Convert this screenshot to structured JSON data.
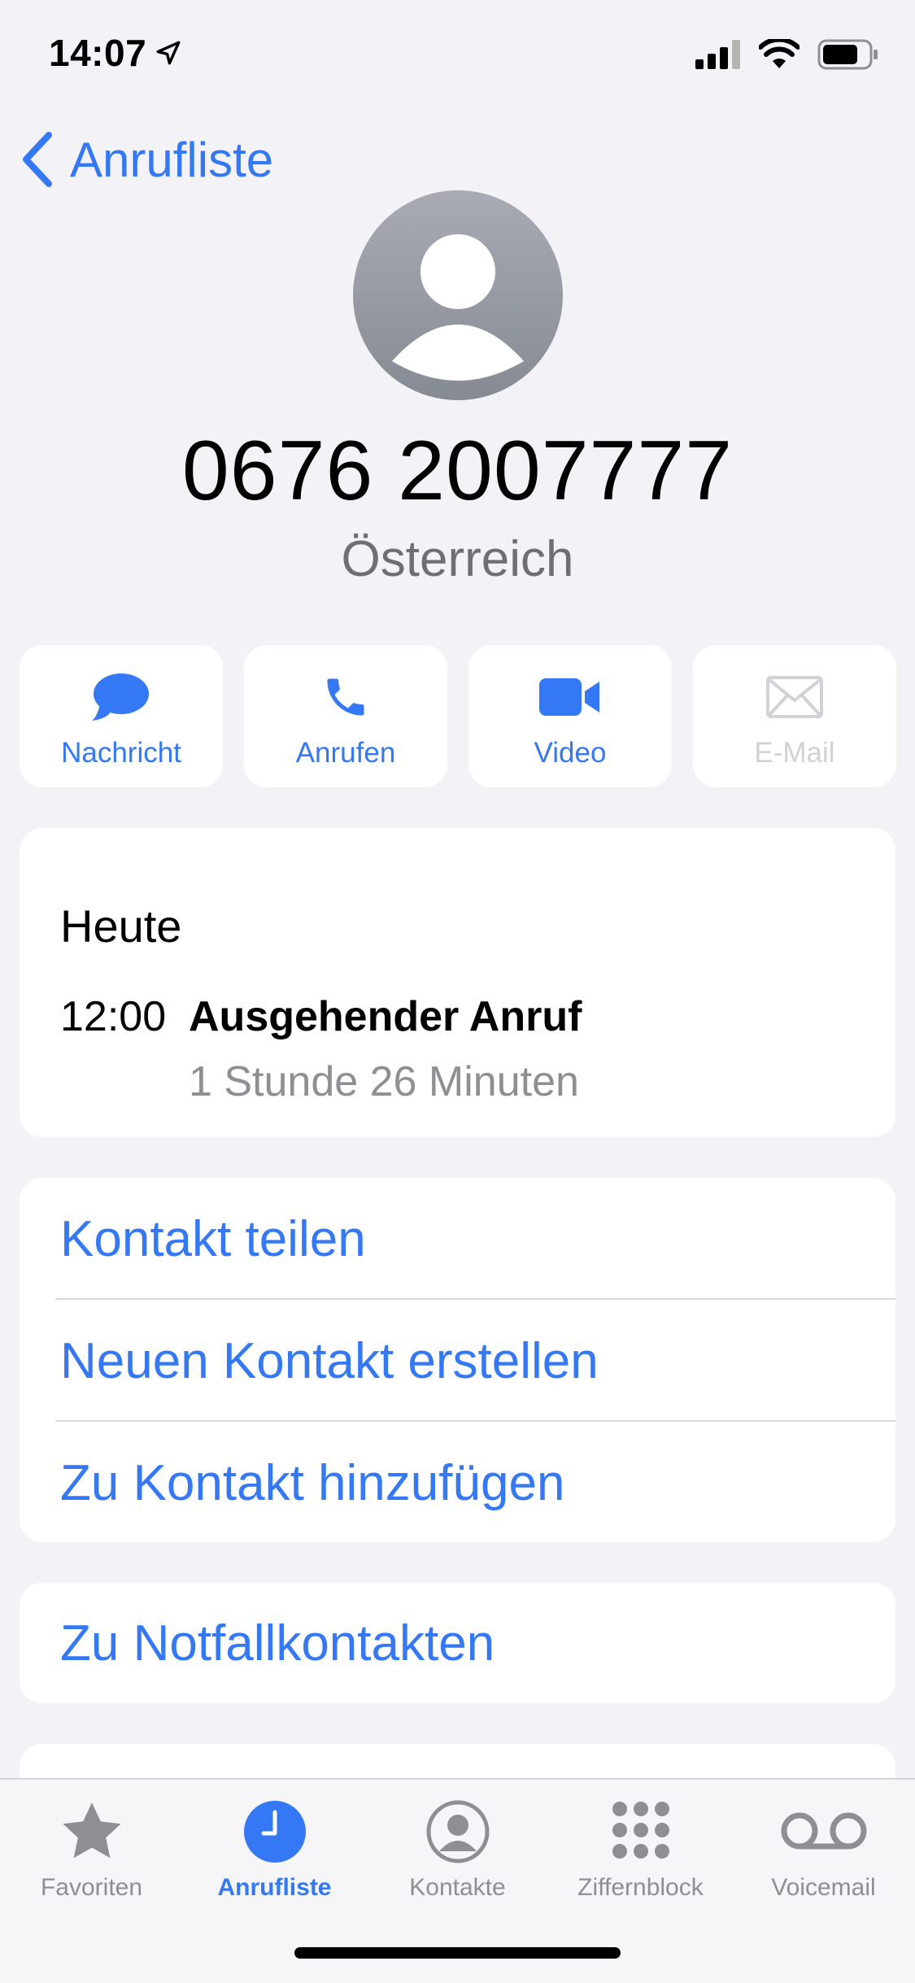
{
  "status_bar": {
    "time": "14:07"
  },
  "nav": {
    "back_label": "Anrufliste"
  },
  "contact": {
    "number": "0676 2007777",
    "country": "Österreich"
  },
  "actions": [
    {
      "label": "Nachricht",
      "icon": "message-icon",
      "enabled": true
    },
    {
      "label": "Anrufen",
      "icon": "phone-icon",
      "enabled": true
    },
    {
      "label": "Video",
      "icon": "video-icon",
      "enabled": true
    },
    {
      "label": "E-Mail",
      "icon": "mail-icon",
      "enabled": false
    }
  ],
  "history": {
    "date": "Heute",
    "time": "12:00",
    "type": "Ausgehender Anruf",
    "duration": "1 Stunde 26 Minuten"
  },
  "options": {
    "share": "Kontakt teilen",
    "new_contact": "Neuen Kontakt erstellen",
    "add_to_contact": "Zu Kontakt hinzufügen",
    "emergency": "Zu Notfallkontakten"
  },
  "tabbar": [
    {
      "label": "Favoriten",
      "icon": "star-icon",
      "active": false
    },
    {
      "label": "Anrufliste",
      "icon": "clock-icon",
      "active": true
    },
    {
      "label": "Kontakte",
      "icon": "person-circle-icon",
      "active": false
    },
    {
      "label": "Ziffernblock",
      "icon": "keypad-icon",
      "active": false
    },
    {
      "label": "Voicemail",
      "icon": "voicemail-icon",
      "active": false
    }
  ],
  "colors": {
    "accent": "#3478f6",
    "background": "#f2f2f7",
    "secondary_text": "#8e8e93",
    "disabled": "#d1d1d6"
  }
}
